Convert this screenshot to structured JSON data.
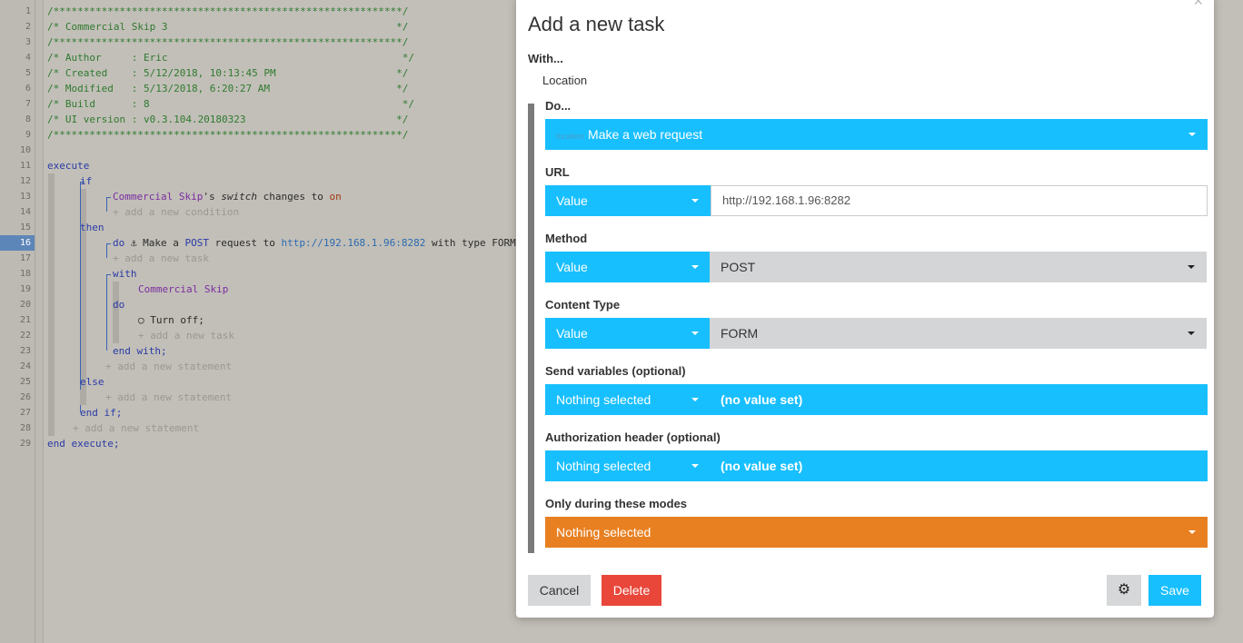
{
  "editor": {
    "lines": [
      "1",
      "2",
      "3",
      "4",
      "5",
      "6",
      "7",
      "8",
      "9",
      "10",
      "11",
      "12",
      "13",
      "14",
      "15",
      "16",
      "17",
      "18",
      "19",
      "20",
      "21",
      "22",
      "23",
      "24",
      "25",
      "26",
      "27",
      "28",
      "29"
    ],
    "active_line": "16",
    "header": {
      "border": "/**********************************************************/",
      "title": "/* Commercial Skip 3                                      */",
      "author": "/* Author     : Eric                                       */",
      "created": "/* Created    : 5/12/2018, 10:13:45 PM                    */",
      "modified": "/* Modified   : 5/13/2018, 6:20:27 AM                     */",
      "build": "/* Build      : 8                                          */",
      "ui_version": "/* UI version : v0.3.104.20180323                         */"
    },
    "execute": "execute",
    "if": "if",
    "cond_device": "Commercial Skip",
    "cond_possessive": "'s ",
    "cond_attr": "switch",
    "cond_changes": " changes to ",
    "cond_value": "on",
    "add_condition": "+ add a new condition",
    "then": "then",
    "do_kw": "do",
    "anchor_icon": "⚓",
    "task_prefix": " Make a ",
    "task_method": "POST",
    "task_mid": " request to ",
    "task_url": "http://192.168.1.96:8282",
    "task_suffix": " with type FORM",
    "add_task": "+ add a new task",
    "with_kw": "with",
    "with_device": "Commercial Skip",
    "do_kw2": "do",
    "power_icon": "○",
    "turn_off": " Turn off;",
    "add_task2": "+ add a new task",
    "end_with": "end with;",
    "add_statement": "+ add a new statement",
    "else": "else",
    "add_statement2": "+ add a new statement",
    "end_if": "end if;",
    "add_statement3": "+ add a new statement",
    "end_execute": "end execute;"
  },
  "modal": {
    "title": "Add a new task",
    "close_icon": "×",
    "with_label": "With...",
    "with_value": "Location",
    "do_label": "Do...",
    "do_tag": "location",
    "do_value": "Make a web request",
    "url_label": "URL",
    "url_type": "Value",
    "url_value": "http://192.168.1.96:8282",
    "method_label": "Method",
    "method_type": "Value",
    "method_value": "POST",
    "content_label": "Content Type",
    "content_type": "Value",
    "content_value": "FORM",
    "send_label": "Send variables (optional)",
    "send_select": "Nothing selected",
    "send_value": "(no value set)",
    "auth_label": "Authorization header (optional)",
    "auth_select": "Nothing selected",
    "auth_value": "(no value set)",
    "modes_label": "Only during these modes",
    "modes_select": "Nothing selected",
    "cancel": "Cancel",
    "delete": "Delete",
    "gear_icon": "⚙",
    "save": "Save"
  },
  "colors": {
    "accent_blue": "#18bfff",
    "delete_red": "#e8473a",
    "modes_orange": "#e88022",
    "comment_green": "#2f7a2f"
  }
}
